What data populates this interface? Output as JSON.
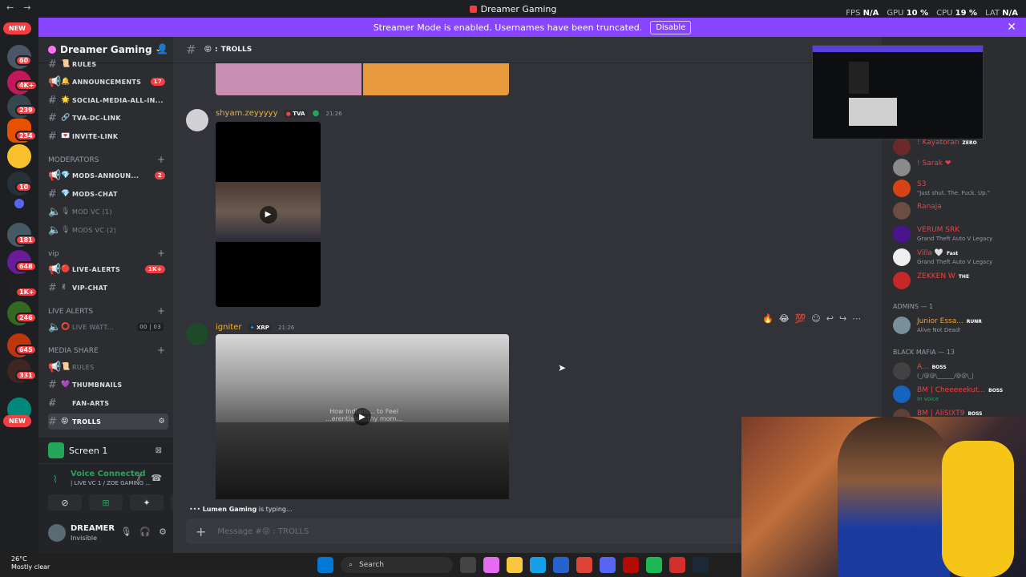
{
  "titlebar": {
    "title": "Dreamer Gaming",
    "fps_label": "FPS",
    "fps": "N/A",
    "gpu_label": "GPU",
    "gpu": "10 %",
    "cpu_label": "CPU",
    "cpu": "19 %",
    "lat_label": "LAT",
    "lat": "N/A"
  },
  "banner": {
    "text": "Streamer Mode is enabled. Usernames have been truncated.",
    "button": "Disable"
  },
  "rail": {
    "new_top": "NEW",
    "new_bottom": "NEW",
    "badges": [
      "60",
      "4K+",
      "239",
      "234",
      "10",
      "181",
      "648",
      "1K+",
      "246",
      "645",
      "331"
    ]
  },
  "sidebar": {
    "guild_name": "Dreamer Gaming",
    "channels": [
      {
        "icon": "📜",
        "label": "RULES"
      },
      {
        "icon": "🔔",
        "label": "ANNOUNCEMENTS",
        "count": "17"
      },
      {
        "icon": "🌟",
        "label": "SOCIAL-MEDIA-ALL-IN..."
      },
      {
        "icon": "🔗",
        "label": "TVA-DC-LINK"
      },
      {
        "icon": "💌",
        "label": "INVITE-LINK"
      }
    ],
    "cat_moderators": "MODERATORS",
    "mod_channels": [
      {
        "icon": "💎",
        "label": "MODS-ANNOUN...",
        "count": "2"
      },
      {
        "icon": "💎",
        "label": "MODS-CHAT"
      },
      {
        "icon": "🎙",
        "label": "MOD VC (1)"
      },
      {
        "icon": "🎙",
        "label": "MODS VC (2)"
      }
    ],
    "cat_vip": "vip",
    "vip_channels": [
      {
        "icon": "🔴",
        "label": "LIVE-ALERTS",
        "count": "1K+"
      },
      {
        "icon": "✌",
        "label": "VIP-CHAT"
      }
    ],
    "cat_live": "LIVE ALERTS",
    "live_channels": [
      {
        "icon": "⭕",
        "label": "LIVE WATT...",
        "count_a": "00",
        "count_b": "03"
      }
    ],
    "cat_media": "MEDIA SHARE",
    "media_channels": [
      {
        "icon": "📜",
        "label": "RULES"
      },
      {
        "icon": "💜",
        "label": "THUMBNAILS"
      },
      {
        "icon": "",
        "label": "FAN-ARTS"
      },
      {
        "icon": "😝",
        "label": "TROLLS"
      }
    ]
  },
  "screen_panel": {
    "label": "Screen 1"
  },
  "voice_panel": {
    "status": "Voice Connected",
    "channel": "| LIVE VC 1 / ZOE GAMING ..."
  },
  "user_panel": {
    "name": "DREAMER",
    "status": "Invisible"
  },
  "channel_header": {
    "emoji": "😝",
    "name": "TROLLS"
  },
  "messages": [
    {
      "author": "shyam.zeyyyyy",
      "tag": "TVA",
      "time": "21:26"
    },
    {
      "author": "igniter",
      "tag": "XRP",
      "time": "21:26",
      "overlay": "How Indians... to Feel ...erentials ...thy mom..."
    }
  ],
  "typing": {
    "name": "Lumen Gaming",
    "suffix": "is typing..."
  },
  "composer": {
    "placeholder": "Message #😝 : TROLLS"
  },
  "members": {
    "top": [
      {
        "name": "! Kayatoran",
        "tag": "ZERO",
        "color": "#ed4245"
      },
      {
        "name": "! Sarak ❤",
        "tag": "",
        "color": "#ed4245"
      },
      {
        "name": "S3",
        "sub": "\"Just shut. The. Fuck. Up.\"",
        "color": "#ed4245"
      },
      {
        "name": "Ranaja",
        "tag": "",
        "color": "#ed4245"
      },
      {
        "name": "VERUM SRK",
        "sub": "Grand Theft Auto V Legacy",
        "color": "#ed4245"
      },
      {
        "name": "Villa 🤍",
        "tag": "Fast",
        "sub": "Grand Theft Auto V Legacy",
        "color": "#ed4245"
      },
      {
        "name": "ZEKKEN W",
        "tag": "THE",
        "color": "#ed4245"
      }
    ],
    "admins_label": "ADMINS — 1",
    "admins": [
      {
        "name": "Junior Essa...",
        "tag": "RUNR",
        "sub": "Alive Not Dead!",
        "color": "#f0a232"
      }
    ],
    "mafia_label": "BLACK MAFIA — 13",
    "mafia": [
      {
        "name": "A...",
        "tag": "BOSS",
        "sub": "(_/@@\\______/@@\\_|",
        "color": "#ed4245"
      },
      {
        "name": "BM | Cheeeeekut...",
        "tag": "BOSS",
        "sub": "In voice",
        "color": "#ed4245"
      },
      {
        "name": "BM | AliSIXT9",
        "tag": "BOSS",
        "color": "#ed4245"
      }
    ]
  },
  "taskbar": {
    "temp": "26°C",
    "weather": "Mostly clear",
    "search": "Search"
  }
}
